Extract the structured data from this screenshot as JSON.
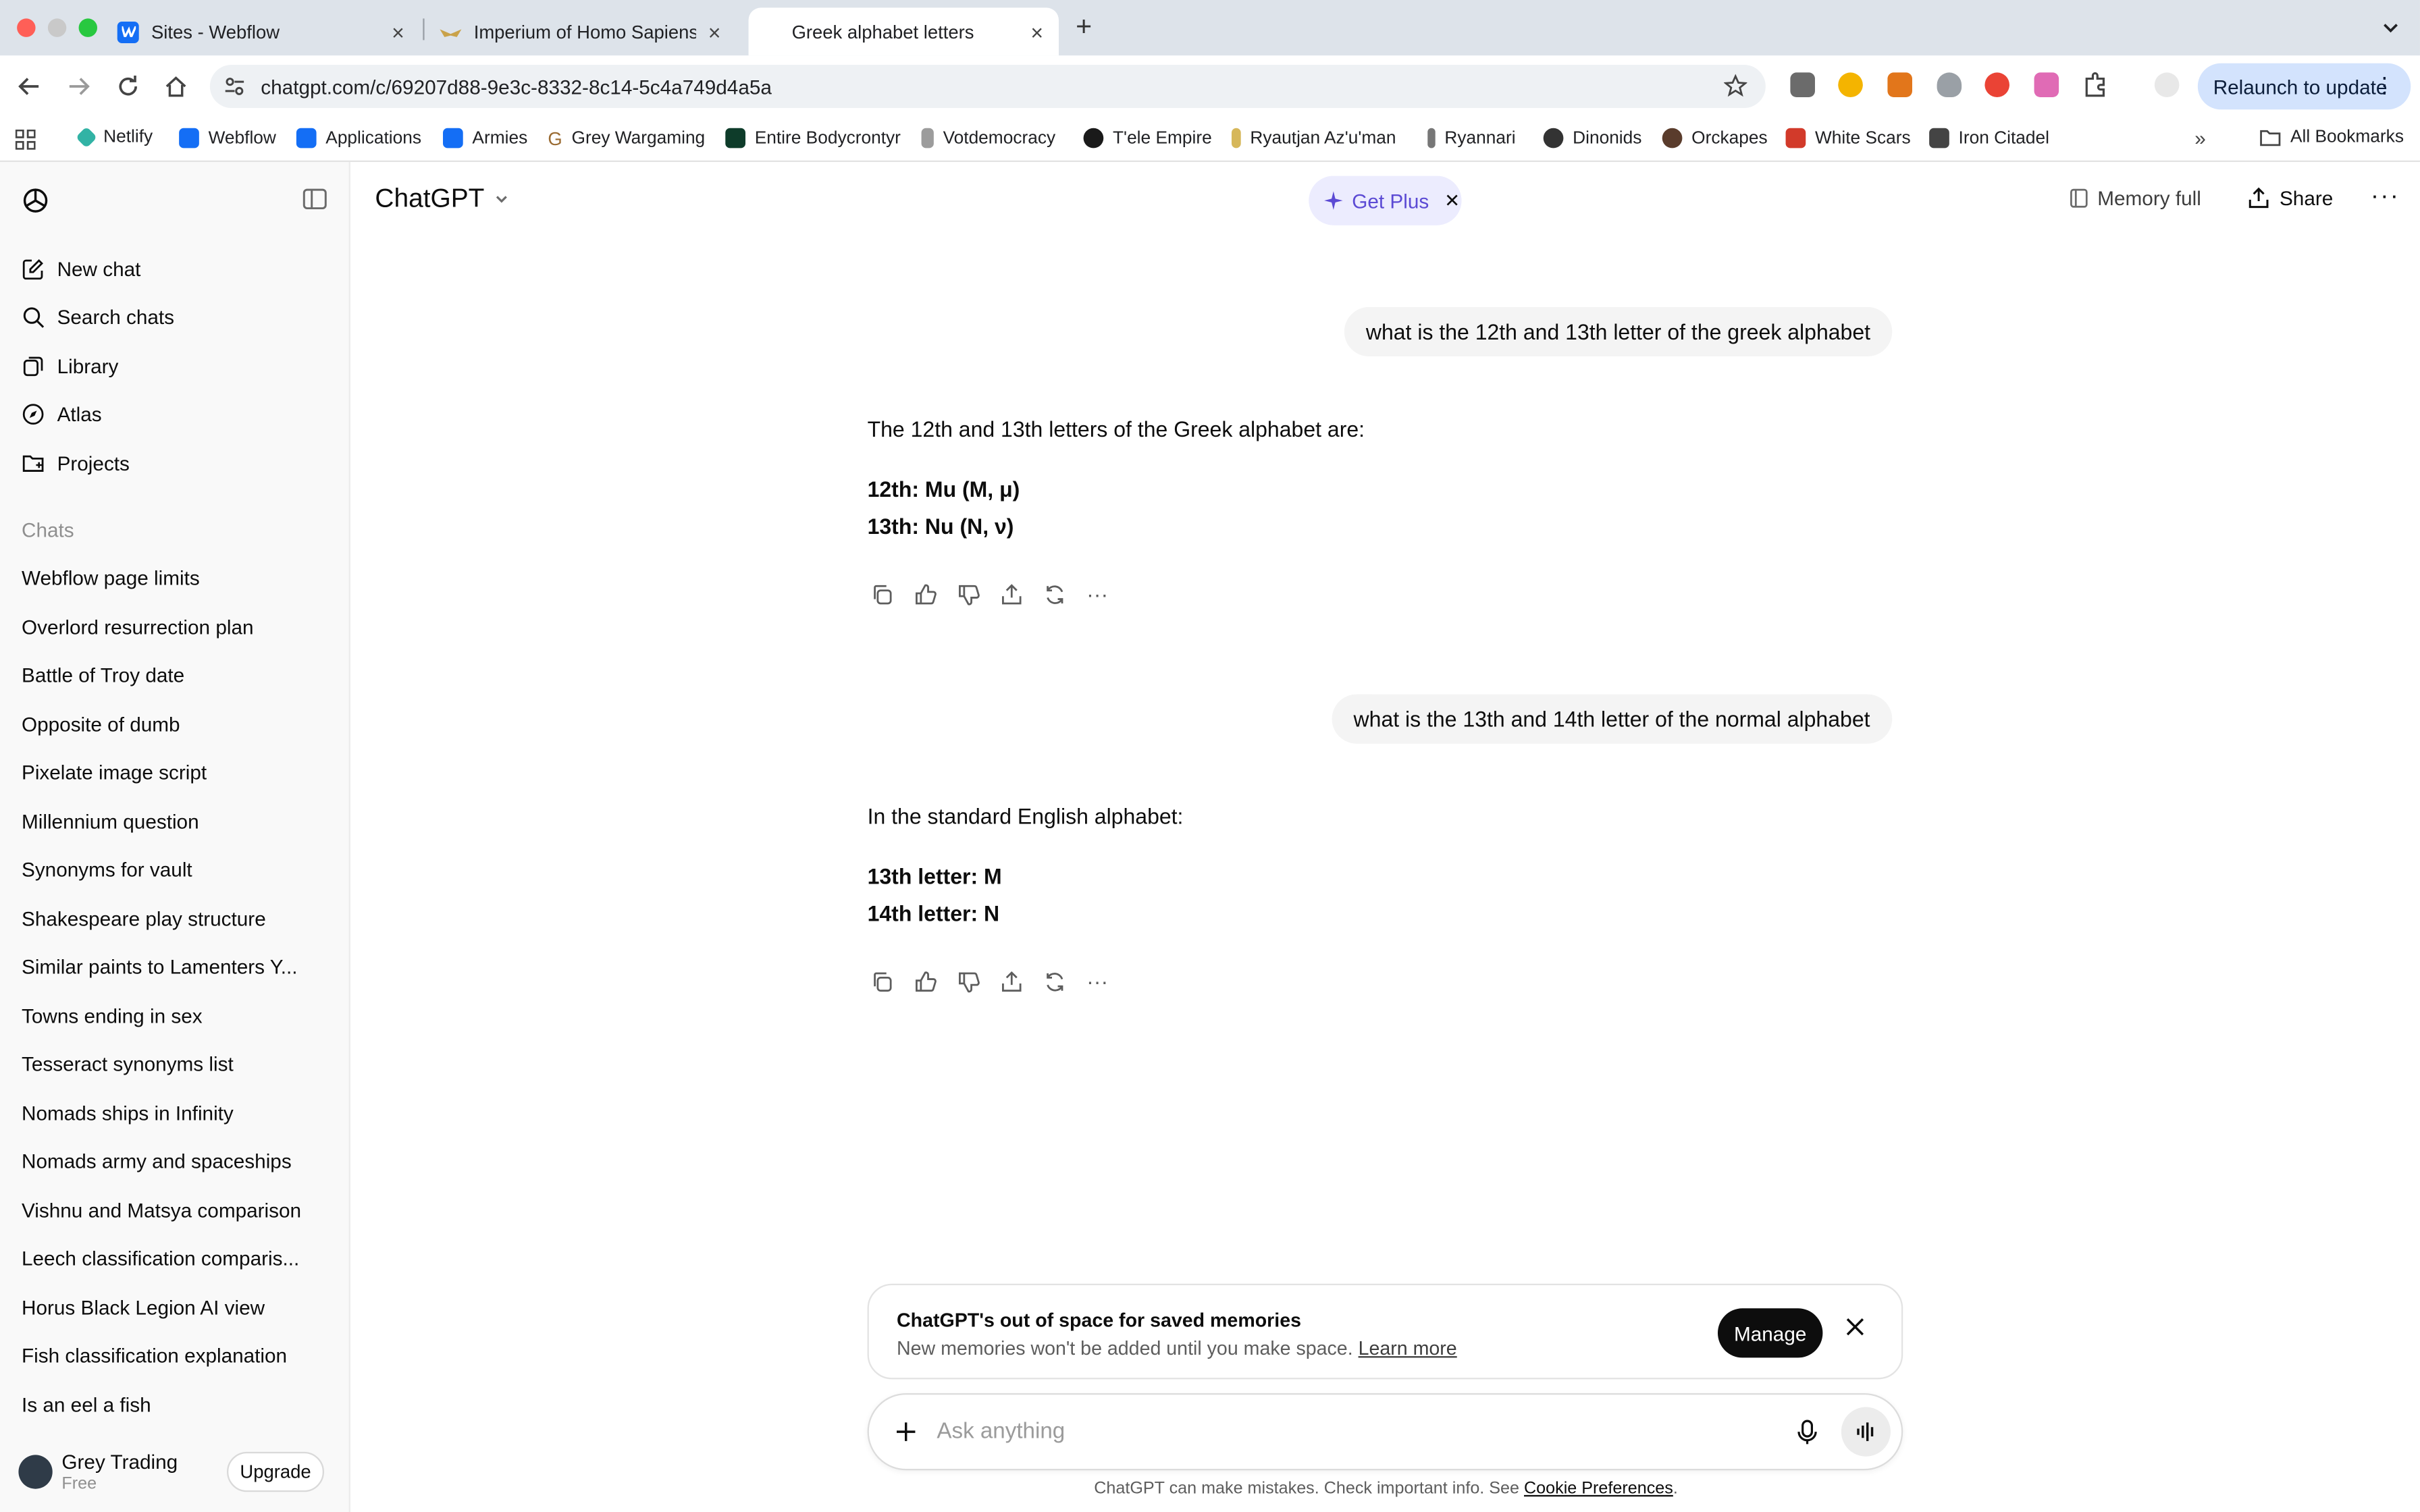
{
  "browser": {
    "tabs": [
      {
        "title": "Sites - Webflow",
        "active": false
      },
      {
        "title": "Imperium of Homo Sapiens",
        "active": false
      },
      {
        "title": "Greek alphabet letters",
        "active": true
      }
    ],
    "url": "chatgpt.com/c/69207d88-9e3c-8332-8c14-5c4a749d4a5a",
    "relaunch_label": "Relaunch to update",
    "bookmarks": [
      "Netlify",
      "Webflow",
      "Applications",
      "Armies",
      "Grey Wargaming",
      "Entire Bodycrontyr",
      "Votdemocracy",
      "T'ele Empire",
      "Ryautjan Az'u'man",
      "Ryannari",
      "Dinonids",
      "Orckapes",
      "White Scars",
      "Iron Citadel"
    ],
    "all_bookmarks": "All Bookmarks"
  },
  "sidebar": {
    "nav": [
      "New chat",
      "Search chats",
      "Library",
      "Atlas",
      "Projects"
    ],
    "chats_label": "Chats",
    "chats": [
      "Webflow page limits",
      "Overlord resurrection plan",
      "Battle of Troy date",
      "Opposite of dumb",
      "Pixelate image script",
      "Millennium question",
      "Synonyms for vault",
      "Shakespeare play structure",
      "Similar paints to Lamenters Y...",
      "Towns ending in sex",
      "Tesseract synonyms list",
      "Nomads ships in Infinity",
      "Nomads army and spaceships",
      "Vishnu and Matsya comparison",
      "Leech classification comparis...",
      "Horus Black Legion AI view",
      "Fish classification explanation",
      "Is an eel a fish"
    ],
    "user": {
      "name": "Grey Trading",
      "plan": "Free"
    },
    "upgrade_label": "Upgrade"
  },
  "header": {
    "model": "ChatGPT",
    "get_plus": "Get Plus",
    "memory": "Memory full",
    "share": "Share"
  },
  "conversation": [
    {
      "user": "what is the 12th and 13th letter of the greek alphabet",
      "intro": "The 12th and 13th letters of the Greek alphabet are:",
      "lines": [
        "12th: Mu (Μ, μ)",
        "13th: Nu (Ν, ν)"
      ]
    },
    {
      "user": "what is the 13th and 14th letter of the normal alphabet",
      "intro": "In the standard English alphabet:",
      "lines": [
        "13th letter: M",
        "14th letter: N"
      ]
    }
  ],
  "memory_banner": {
    "title": "ChatGPT's out of space for saved memories",
    "subtitle": "New memories won't be added until you make space.",
    "link": "Learn more",
    "manage": "Manage"
  },
  "composer": {
    "placeholder": "Ask anything"
  },
  "disclaimer": {
    "text": "ChatGPT can make mistakes. Check important info. See",
    "link": "Cookie Preferences",
    "end": "."
  }
}
